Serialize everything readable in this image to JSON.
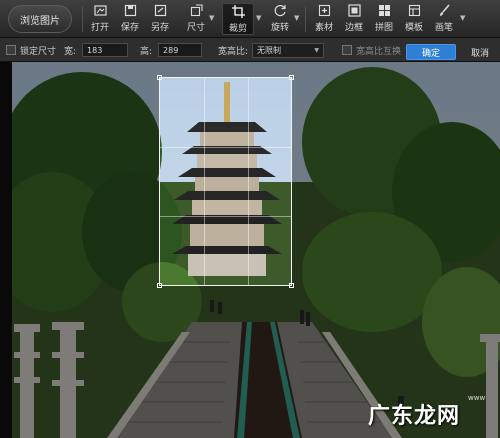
{
  "toolbar": {
    "browse_label": "浏览图片",
    "tools": [
      {
        "label": "打开",
        "icon": "open-icon"
      },
      {
        "label": "保存",
        "icon": "save-icon"
      },
      {
        "label": "另存",
        "icon": "save-as-icon"
      },
      {
        "label": "尺寸",
        "icon": "resize-icon"
      },
      {
        "label": "裁剪",
        "icon": "crop-icon"
      },
      {
        "label": "旋转",
        "icon": "rotate-icon"
      },
      {
        "label": "素材",
        "icon": "material-icon"
      },
      {
        "label": "边框",
        "icon": "frame-icon"
      },
      {
        "label": "拼图",
        "icon": "collage-icon"
      },
      {
        "label": "模板",
        "icon": "template-icon"
      },
      {
        "label": "画笔",
        "icon": "brush-icon"
      }
    ],
    "active_tool": "裁剪"
  },
  "options": {
    "lock_size_label": "锁定尺寸",
    "width_label": "宽:",
    "width_value": "183",
    "height_label": "高:",
    "height_value": "289",
    "ratio_label": "宽高比:",
    "ratio_value": "无限制",
    "swap_label": "宽高比互换",
    "confirm_label": "确定",
    "cancel_label": "取消"
  },
  "watermark": {
    "text": "广东龙网",
    "small": "www"
  },
  "colors": {
    "accent": "#2f7fd6",
    "toolbar_bg": "#2e2e2e"
  }
}
